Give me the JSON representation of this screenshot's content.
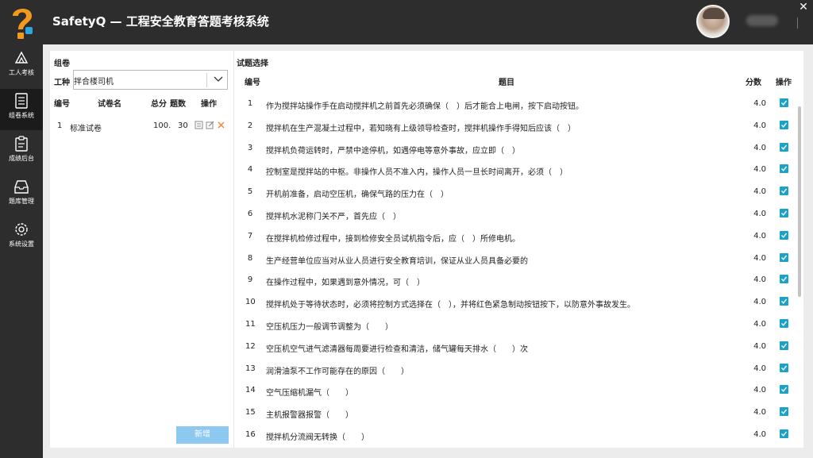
{
  "app": {
    "title": "SafetyQ — 工程安全教育答题考核系统",
    "close_symbol": "✕"
  },
  "sidebar": {
    "items": [
      {
        "label": "工人考核",
        "icon": "construction-worker-icon"
      },
      {
        "label": "组卷系统",
        "icon": "document-list-icon",
        "active": true
      },
      {
        "label": "成绩后台",
        "icon": "clipboard-icon"
      },
      {
        "label": "题库管理",
        "icon": "inbox-tray-icon"
      },
      {
        "label": "系统设置",
        "icon": "gear-icon"
      }
    ]
  },
  "left_panel": {
    "title": "组卷",
    "worktype_label": "工种",
    "worktype_value": "拌合楼司机",
    "headers": {
      "id": "编号",
      "name": "试卷名",
      "total": "总分",
      "count": "题数",
      "ops": "操作"
    },
    "papers": [
      {
        "id": "1",
        "name": "标准试卷",
        "total": "100.0",
        "count": "30"
      }
    ],
    "add_button": "新增"
  },
  "right_panel": {
    "title": "试题选择",
    "headers": {
      "id": "编号",
      "question": "题目",
      "score": "分数",
      "ops": "操作"
    },
    "questions": [
      {
        "id": "1",
        "text": "作为搅拌站操作手在启动搅拌机之前首先必须确保（　）后才能合上电闸，按下启动按钮。",
        "score": "4.0",
        "checked": true
      },
      {
        "id": "2",
        "text": "搅拌机在生产混凝土过程中，若知晓有上级领导检查时，搅拌机操作手得知后应该（　）",
        "score": "4.0",
        "checked": true
      },
      {
        "id": "3",
        "text": "搅拌机负荷运转时，严禁中途停机，如遇停电等意外事故，应立即（　）",
        "score": "4.0",
        "checked": true
      },
      {
        "id": "4",
        "text": "控制室是搅拌站的中枢。非操作人员不准入内，操作人员一旦长时间离开，必须（　）",
        "score": "4.0",
        "checked": true
      },
      {
        "id": "5",
        "text": "开机前准备，启动空压机，确保气路的压力在（　）",
        "score": "4.0",
        "checked": true
      },
      {
        "id": "6",
        "text": "搅拌机水泥称门关不严，首先应（　）",
        "score": "4.0",
        "checked": true
      },
      {
        "id": "7",
        "text": "在搅拌机检修过程中，接到检修安全员试机指令后，应（　）所修电机。",
        "score": "4.0",
        "checked": true
      },
      {
        "id": "8",
        "text": "生产经营单位应当对从业人员进行安全教育培训，保证从业人员具备必要的",
        "score": "4.0",
        "checked": true
      },
      {
        "id": "9",
        "text": "在操作过程中，如果遇到意外情况，可（　）",
        "score": "4.0",
        "checked": true
      },
      {
        "id": "10",
        "text": "搅拌机处于等待状态时，必须将控制方式选择在（　），并将红色紧急制动按钮按下，以防意外事故发生。",
        "score": "4.0",
        "checked": true
      },
      {
        "id": "11",
        "text": "空压机压力一般调节调整为（　　）",
        "score": "4.0",
        "checked": true
      },
      {
        "id": "12",
        "text": "空压机空气进气滤清器每周要进行检查和清洁，储气罐每天排水（　　）次",
        "score": "4.0",
        "checked": true
      },
      {
        "id": "13",
        "text": "润滑油泵不工作可能存在的原因（　　）",
        "score": "4.0",
        "checked": true
      },
      {
        "id": "14",
        "text": "空气压缩机漏气（　　）",
        "score": "4.0",
        "checked": true
      },
      {
        "id": "15",
        "text": "主机报警器报警（　　）",
        "score": "4.0",
        "checked": true
      },
      {
        "id": "16",
        "text": "搅拌机分流阀无转换（　　）",
        "score": "4.0",
        "checked": true
      }
    ]
  },
  "colors": {
    "sidebar_bg": "#2d2d2d",
    "accent": "#1aa3c7",
    "add_button": "#8cc8ef",
    "logo_orange": "#f39a1e",
    "logo_blue": "#2aa7df"
  }
}
